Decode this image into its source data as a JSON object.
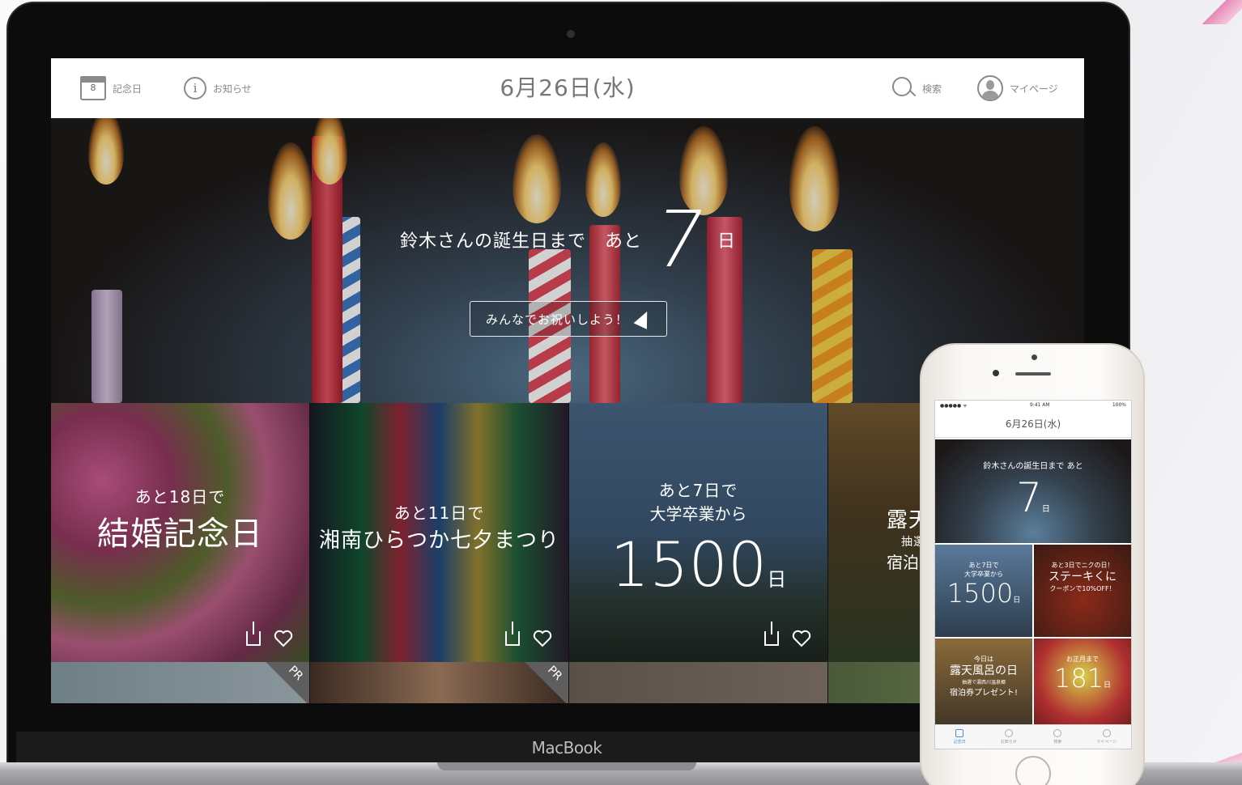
{
  "topbar": {
    "calendar_day": "8",
    "anniversary_label": "記念日",
    "notice_label": "お知らせ",
    "date": "6月26日(水)",
    "search_label": "検索",
    "mypage_label": "マイページ"
  },
  "hero": {
    "message": "鈴木さんの誕生日まで　あと",
    "days": "7",
    "unit": "日",
    "button_label": "みんなでお祝いしよう！"
  },
  "cards": [
    {
      "pre": "あと18日で",
      "title": "結婚記念日"
    },
    {
      "pre": "あと11日で",
      "title": "湘南ひらつか七夕まつり"
    },
    {
      "pre": "あと7日で",
      "sub": "大学卒業から",
      "number": "1500",
      "unit": "日"
    },
    {
      "pre": "抽選",
      "title": "露天",
      "sub": "宿泊"
    }
  ],
  "pr_label": "PR",
  "laptop_label": "MacBook",
  "phone": {
    "status_left": "●●●●● ᯤ",
    "status_time": "9:41 AM",
    "status_right": "100%",
    "title": "6月26日(水)",
    "hero_message": "鈴木さんの誕生日まで あと",
    "hero_days": "7",
    "hero_unit": "日",
    "cards": [
      {
        "l1": "あと7日で",
        "l2": "大学卒業から",
        "big": "1500",
        "unit": "日"
      },
      {
        "l1": "あと3日でニクの日！",
        "l2": "ステーキくに",
        "l3": "クーポンで10%OFF！"
      },
      {
        "l1": "今日は",
        "l2": "露天風呂の日",
        "l3": "抽選で湯西川温泉郷",
        "l4": "宿泊券プレゼント!"
      },
      {
        "l1": "お正月まで",
        "big": "181",
        "unit": "日"
      }
    ],
    "tabs": [
      "記念日",
      "お知らせ",
      "検索",
      "マイページ"
    ]
  },
  "colors": {
    "accent": "#4a90d9",
    "badge": "#5e5e5e"
  }
}
